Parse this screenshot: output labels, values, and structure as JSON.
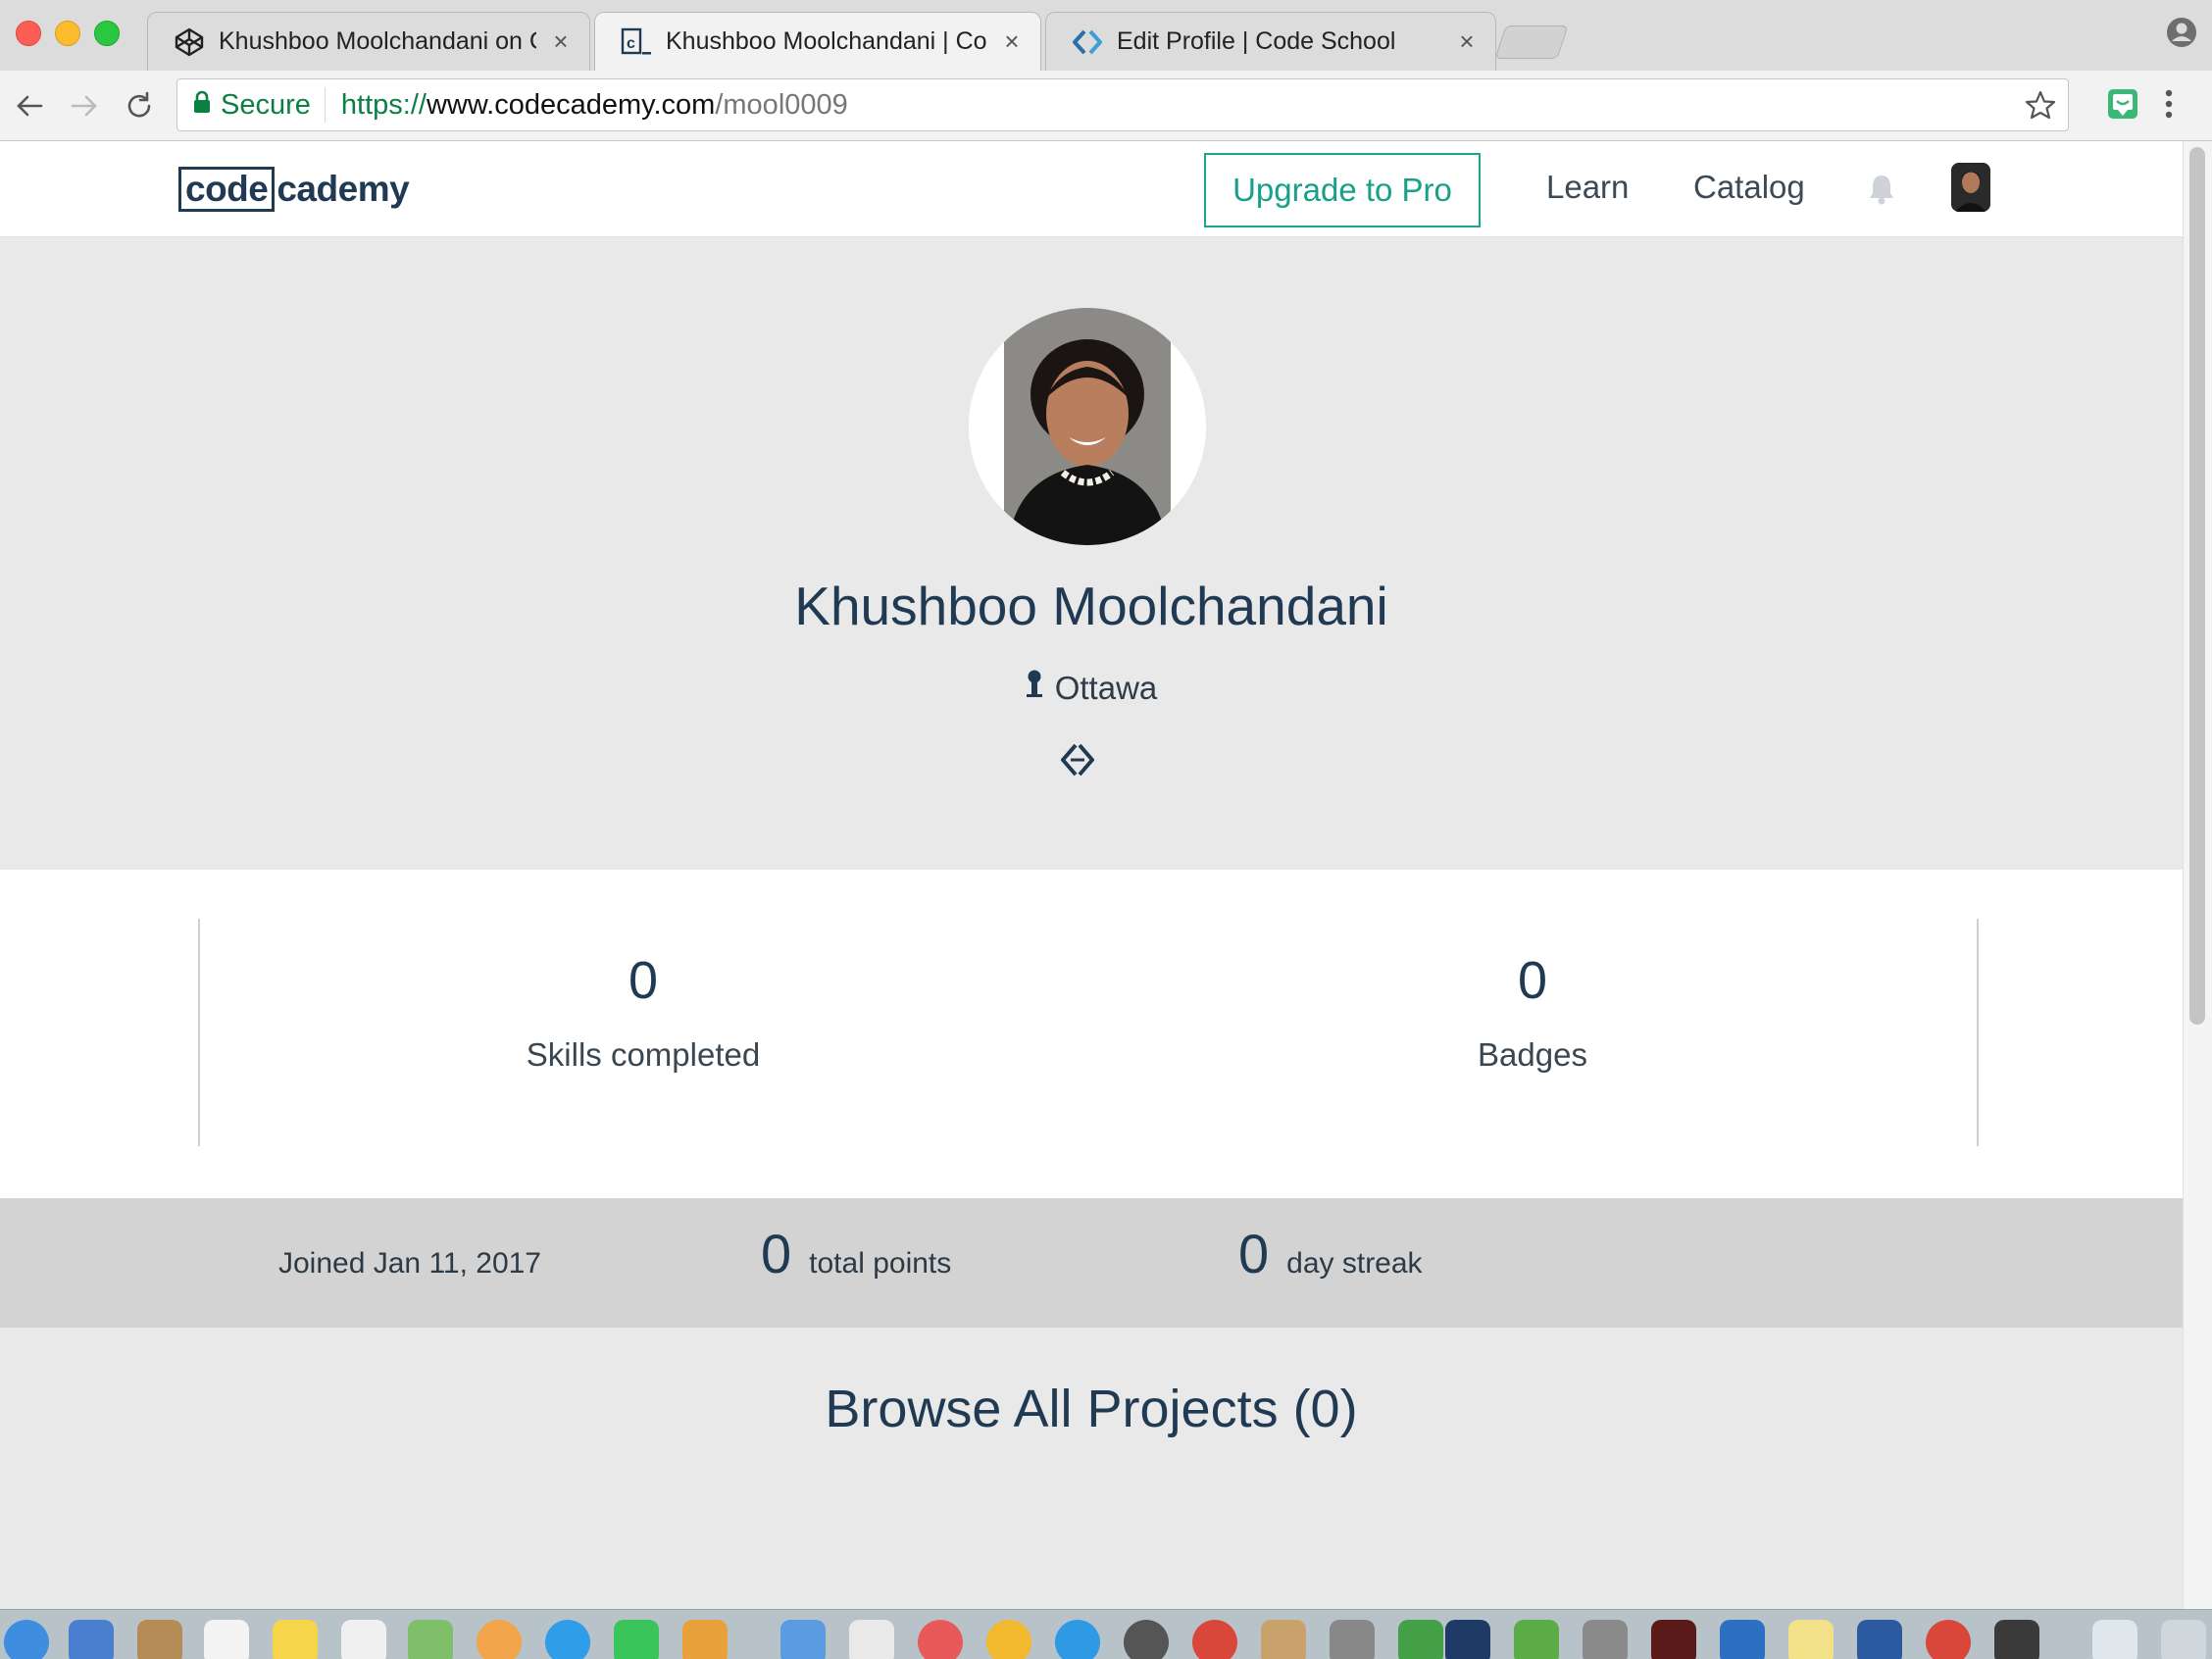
{
  "browser": {
    "tabs": [
      {
        "title": "Khushboo Moolchandani on Co",
        "icon": "codepen-icon",
        "active": false
      },
      {
        "title": "Khushboo Moolchandani | Cod",
        "icon": "codecademy-icon",
        "active": true
      },
      {
        "title": "Edit Profile | Code School",
        "icon": "code-brackets-icon",
        "active": false
      }
    ],
    "close_glyph": "×",
    "secure_label": "Secure",
    "url": {
      "scheme": "https://",
      "host": "www.codecademy.com",
      "path": "/mool0009"
    }
  },
  "site": {
    "logo": {
      "boxed": "code",
      "rest": "cademy"
    },
    "upgrade_label": "Upgrade to Pro",
    "nav": {
      "learn": "Learn",
      "catalog": "Catalog"
    }
  },
  "profile": {
    "name": "Khushboo Moolchandani",
    "location": "Ottawa"
  },
  "stats": {
    "skills": {
      "value": "0",
      "label": "Skills completed"
    },
    "badges": {
      "value": "0",
      "label": "Badges"
    }
  },
  "meta": {
    "joined": "Joined Jan 11, 2017",
    "points": {
      "value": "0",
      "label": "total points"
    },
    "streak": {
      "value": "0",
      "label": "day streak"
    }
  },
  "projects": {
    "title": "Browse All Projects (0)"
  },
  "colors": {
    "brand_navy": "#1f3a52",
    "accent_teal": "#17a08a",
    "secure_green": "#0b8043"
  }
}
